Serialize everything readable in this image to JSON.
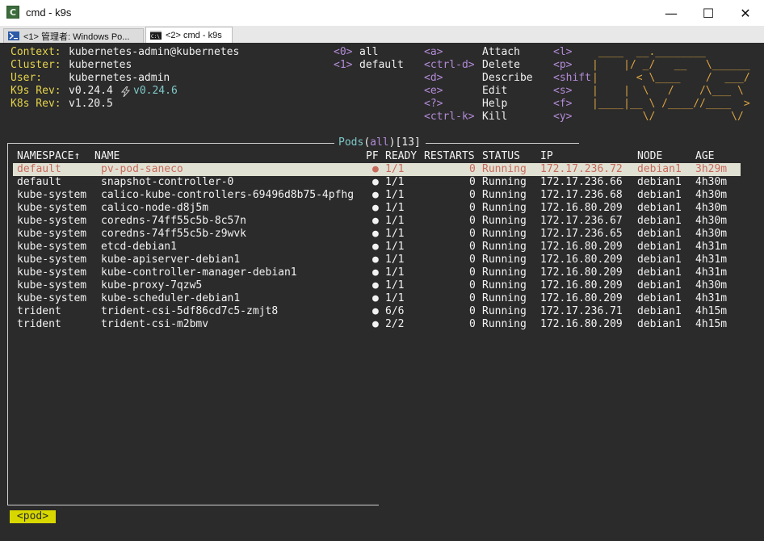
{
  "window": {
    "title": "cmd - k9s",
    "app_icon_letter": "C",
    "controls": {
      "minimize": "—",
      "maximize": "☐",
      "close": "✕"
    }
  },
  "tabs": [
    {
      "label": "<1> 管理者: Windows Po...",
      "icon": "powershell-icon"
    },
    {
      "label": "<2> cmd - k9s",
      "icon": "cmd-icon"
    }
  ],
  "info": {
    "context_label": "Context:",
    "context": "kubernetes-admin@kubernetes",
    "cluster_label": "Cluster:",
    "cluster": "kubernetes",
    "user_label": "User:",
    "user": "kubernetes-admin",
    "k9s_rev_label": "K9s Rev:",
    "k9s_rev": "v0.24.4",
    "k9s_update": "v0.24.6",
    "k8s_rev_label": "K8s Rev:",
    "k8s_rev": "v1.20.5"
  },
  "namespaces": [
    {
      "key": "<0>",
      "name": "all"
    },
    {
      "key": "<1>",
      "name": "default"
    }
  ],
  "shortcuts_col1": [
    {
      "key": "<a>",
      "action": "Attach"
    },
    {
      "key": "<ctrl-d>",
      "action": "Delete"
    },
    {
      "key": "<d>",
      "action": "Describe"
    },
    {
      "key": "<e>",
      "action": "Edit"
    },
    {
      "key": "<?>",
      "action": "Help"
    },
    {
      "key": "<ctrl-k>",
      "action": "Kill"
    }
  ],
  "shortcuts_col2": [
    "<l>",
    "<p>",
    "<shift",
    "<s>",
    "<f>",
    "<y>"
  ],
  "logo": [
    " ____  __.________ ",
    "|    |/ _/   __   \\______",
    "|      < \\____    /  ___/",
    "|    |  \\   /    /\\___ \\ ",
    "|____|__ \\ /____//____  >",
    "        \\/            \\/ "
  ],
  "panel": {
    "resource": "Pods",
    "namespace": "all",
    "count": "13"
  },
  "table": {
    "headers": [
      "NAMESPACE↑",
      "NAME",
      "PF",
      "READY",
      "RESTARTS",
      "STATUS",
      "IP",
      "NODE",
      "AGE"
    ],
    "rows": [
      {
        "namespace": "default",
        "name": "pv-pod-saneco",
        "pf": "●",
        "ready": "1/1",
        "restarts": "0",
        "status": "Running",
        "ip": "172.17.236.72",
        "node": "debian1",
        "age": "3h29m"
      },
      {
        "namespace": "default",
        "name": "snapshot-controller-0",
        "pf": "●",
        "ready": "1/1",
        "restarts": "0",
        "status": "Running",
        "ip": "172.17.236.66",
        "node": "debian1",
        "age": "4h30m"
      },
      {
        "namespace": "kube-system",
        "name": "calico-kube-controllers-69496d8b75-4pfhg",
        "pf": "●",
        "ready": "1/1",
        "restarts": "0",
        "status": "Running",
        "ip": "172.17.236.68",
        "node": "debian1",
        "age": "4h30m"
      },
      {
        "namespace": "kube-system",
        "name": "calico-node-d8j5m",
        "pf": "●",
        "ready": "1/1",
        "restarts": "0",
        "status": "Running",
        "ip": "172.16.80.209",
        "node": "debian1",
        "age": "4h30m"
      },
      {
        "namespace": "kube-system",
        "name": "coredns-74ff55c5b-8c57n",
        "pf": "●",
        "ready": "1/1",
        "restarts": "0",
        "status": "Running",
        "ip": "172.17.236.67",
        "node": "debian1",
        "age": "4h30m"
      },
      {
        "namespace": "kube-system",
        "name": "coredns-74ff55c5b-z9wvk",
        "pf": "●",
        "ready": "1/1",
        "restarts": "0",
        "status": "Running",
        "ip": "172.17.236.65",
        "node": "debian1",
        "age": "4h30m"
      },
      {
        "namespace": "kube-system",
        "name": "etcd-debian1",
        "pf": "●",
        "ready": "1/1",
        "restarts": "0",
        "status": "Running",
        "ip": "172.16.80.209",
        "node": "debian1",
        "age": "4h31m"
      },
      {
        "namespace": "kube-system",
        "name": "kube-apiserver-debian1",
        "pf": "●",
        "ready": "1/1",
        "restarts": "0",
        "status": "Running",
        "ip": "172.16.80.209",
        "node": "debian1",
        "age": "4h31m"
      },
      {
        "namespace": "kube-system",
        "name": "kube-controller-manager-debian1",
        "pf": "●",
        "ready": "1/1",
        "restarts": "0",
        "status": "Running",
        "ip": "172.16.80.209",
        "node": "debian1",
        "age": "4h31m"
      },
      {
        "namespace": "kube-system",
        "name": "kube-proxy-7qzw5",
        "pf": "●",
        "ready": "1/1",
        "restarts": "0",
        "status": "Running",
        "ip": "172.16.80.209",
        "node": "debian1",
        "age": "4h30m"
      },
      {
        "namespace": "kube-system",
        "name": "kube-scheduler-debian1",
        "pf": "●",
        "ready": "1/1",
        "restarts": "0",
        "status": "Running",
        "ip": "172.16.80.209",
        "node": "debian1",
        "age": "4h31m"
      },
      {
        "namespace": "trident",
        "name": "trident-csi-5df86cd7c5-zmjt8",
        "pf": "●",
        "ready": "6/6",
        "restarts": "0",
        "status": "Running",
        "ip": "172.17.236.71",
        "node": "debian1",
        "age": "4h15m"
      },
      {
        "namespace": "trident",
        "name": "trident-csi-m2bmv",
        "pf": "●",
        "ready": "2/2",
        "restarts": "0",
        "status": "Running",
        "ip": "172.16.80.209",
        "node": "debian1",
        "age": "4h15m"
      }
    ]
  },
  "crumb": "<pod>",
  "colors": {
    "terminal_bg": "#2b2b2b",
    "label_yellow": "#e5d34b",
    "key_purple": "#b38bd8",
    "selected_bg": "#e1e1d3",
    "selected_fg": "#c76b5c",
    "crumb_bg": "#d8d800",
    "logo_orange": "#d9a341"
  }
}
